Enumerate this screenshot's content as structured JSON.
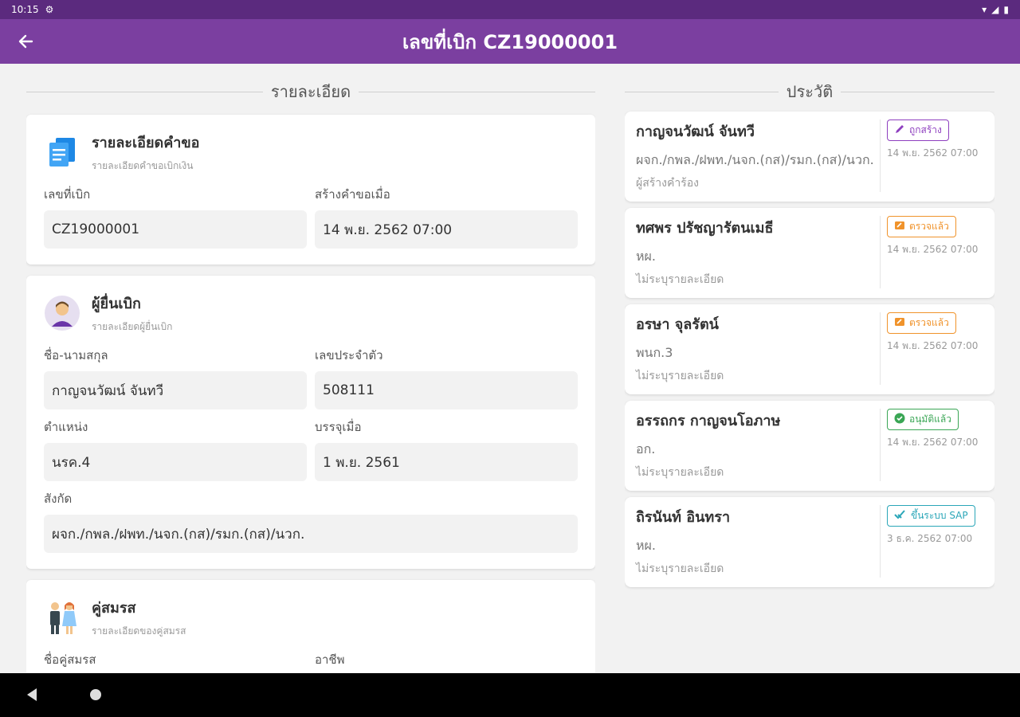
{
  "statusbar": {
    "time": "10:15"
  },
  "appbar": {
    "title": "เลขที่เบิก CZ19000001"
  },
  "left": {
    "heading": "รายละเอียด",
    "request": {
      "title": "รายละเอียดคำขอ",
      "subtitle": "รายละเอียดคำขอเบิกเงิน",
      "fields": [
        {
          "label": "เลขที่เบิก",
          "value": "CZ19000001"
        },
        {
          "label": "สร้างคำขอเมื่อ",
          "value": "14 พ.ย. 2562 07:00"
        }
      ]
    },
    "applicant": {
      "title": "ผู้ยื่นเบิก",
      "subtitle": "รายละเอียดผู้ยื่นเบิก",
      "fields": [
        {
          "label": "ชื่อ-นามสกุล",
          "value": "กาญจนวัฒน์ จันทวี"
        },
        {
          "label": "เลขประจำตัว",
          "value": "508111"
        },
        {
          "label": "ตำแหน่ง",
          "value": "นรค.4"
        },
        {
          "label": "บรรจุเมื่อ",
          "value": "1 พ.ย. 2561"
        },
        {
          "label": "สังกัด",
          "value": "ผจก./กพล./ฝพท./นจก.(กส)/รมก.(กส)/นวก."
        }
      ]
    },
    "spouse": {
      "title": "คู่สมรส",
      "subtitle": "รายละเอียดของคู่สมรส",
      "fields": [
        {
          "label": "ชื่อคู่สมรส",
          "value": ""
        },
        {
          "label": "อาชีพ",
          "value": ""
        }
      ]
    }
  },
  "right": {
    "heading": "ประวัติ",
    "history": [
      {
        "name": "กาญจนวัฒน์ จันทวี",
        "position": "ผจก./กพล./ฝพท./นจก.(กส)/รมก.(กส)/นวก.",
        "note": "ผู้สร้างคำร้อง",
        "badge": "ถูกสร้าง",
        "badge_icon": "pencil-icon",
        "badge_color": "#8e3fbf",
        "time": "14 พ.ย. 2562 07:00"
      },
      {
        "name": "ทศพร ปรัชญารัตนเมธี",
        "position": "หผ.",
        "note": "ไม่ระบุรายละเอียด",
        "badge": "ตรวจแล้ว",
        "badge_icon": "review-icon",
        "badge_color": "#f0932b",
        "time": "14 พ.ย. 2562 07:00"
      },
      {
        "name": "อรษา จุลรัตน์",
        "position": "พนก.3",
        "note": "ไม่ระบุรายละเอียด",
        "badge": "ตรวจแล้ว",
        "badge_icon": "review-icon",
        "badge_color": "#f0932b",
        "time": "14 พ.ย. 2562 07:00"
      },
      {
        "name": "อรรถกร กาญจนโอภาษ",
        "position": "อก.",
        "note": "ไม่ระบุรายละเอียด",
        "badge": "อนุมัติแล้ว",
        "badge_icon": "check-circle-icon",
        "badge_color": "#3aa655",
        "time": "14 พ.ย. 2562 07:00"
      },
      {
        "name": "ถิรนันท์ อินทรา",
        "position": "หผ.",
        "note": "ไม่ระบุรายละเอียด",
        "badge": "ขึ้นระบบ SAP",
        "badge_icon": "double-check-icon",
        "badge_color": "#2aa6b8",
        "time": "3 ธ.ค. 2562 07:00"
      }
    ]
  },
  "colors": {
    "statusbar": "#5b2a7e",
    "appbar": "#7b3fa0",
    "background": "#f2f2f2"
  }
}
